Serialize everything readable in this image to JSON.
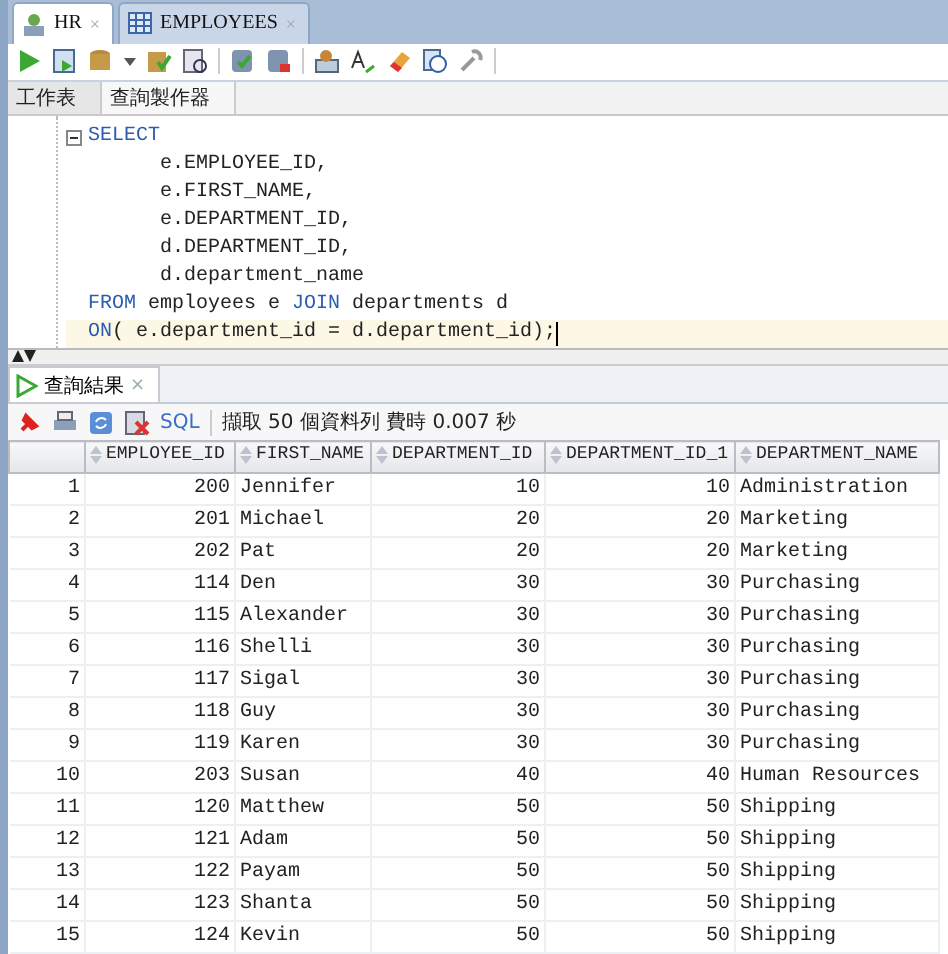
{
  "editor_tabs": [
    {
      "label": "HR",
      "kind": "connection",
      "selected": true,
      "close": "×"
    },
    {
      "label": "EMPLOYEES",
      "kind": "table",
      "selected": false,
      "close": "×"
    }
  ],
  "sub_tabs": [
    {
      "label": "工作表",
      "selected": true
    },
    {
      "label": "查詢製作器",
      "selected": false
    }
  ],
  "sql_lines": [
    {
      "current": false,
      "tokens": [
        {
          "kind": "keyword",
          "text": "SELECT"
        }
      ]
    },
    {
      "current": false,
      "tokens": [
        {
          "kind": "plain",
          "text": "      e.EMPLOYEE_ID,"
        }
      ]
    },
    {
      "current": false,
      "tokens": [
        {
          "kind": "plain",
          "text": "      e.FIRST_NAME,"
        }
      ]
    },
    {
      "current": false,
      "tokens": [
        {
          "kind": "plain",
          "text": "      e.DEPARTMENT_ID,"
        }
      ]
    },
    {
      "current": false,
      "tokens": [
        {
          "kind": "plain",
          "text": "      d.DEPARTMENT_ID,"
        }
      ]
    },
    {
      "current": false,
      "tokens": [
        {
          "kind": "plain",
          "text": "      d.department_name"
        }
      ]
    },
    {
      "current": false,
      "tokens": [
        {
          "kind": "keyword",
          "text": "FROM"
        },
        {
          "kind": "plain",
          "text": " employees e "
        },
        {
          "kind": "keyword",
          "text": "JOIN"
        },
        {
          "kind": "plain",
          "text": " departments d"
        }
      ]
    },
    {
      "current": true,
      "tokens": [
        {
          "kind": "keyword",
          "text": "ON"
        },
        {
          "kind": "plain",
          "text": "( e.department_id = d.department_id);"
        }
      ]
    }
  ],
  "results_tab": {
    "label": "查詢結果",
    "selected": true,
    "close": "×"
  },
  "results_toolbar": {
    "sql_link": "SQL",
    "status": "擷取 50 個資料列 費時 0.007 秒"
  },
  "table": {
    "columns": [
      "",
      "EMPLOYEE_ID",
      "FIRST_NAME",
      "DEPARTMENT_ID",
      "DEPARTMENT_ID_1",
      "DEPARTMENT_NAME"
    ],
    "rows": [
      [
        "1",
        "200",
        "Jennifer",
        "10",
        "10",
        "Administration"
      ],
      [
        "2",
        "201",
        "Michael",
        "20",
        "20",
        "Marketing"
      ],
      [
        "3",
        "202",
        "Pat",
        "20",
        "20",
        "Marketing"
      ],
      [
        "4",
        "114",
        "Den",
        "30",
        "30",
        "Purchasing"
      ],
      [
        "5",
        "115",
        "Alexander",
        "30",
        "30",
        "Purchasing"
      ],
      [
        "6",
        "116",
        "Shelli",
        "30",
        "30",
        "Purchasing"
      ],
      [
        "7",
        "117",
        "Sigal",
        "30",
        "30",
        "Purchasing"
      ],
      [
        "8",
        "118",
        "Guy",
        "30",
        "30",
        "Purchasing"
      ],
      [
        "9",
        "119",
        "Karen",
        "30",
        "30",
        "Purchasing"
      ],
      [
        "10",
        "203",
        "Susan",
        "40",
        "40",
        "Human Resources"
      ],
      [
        "11",
        "120",
        "Matthew",
        "50",
        "50",
        "Shipping"
      ],
      [
        "12",
        "121",
        "Adam",
        "50",
        "50",
        "Shipping"
      ],
      [
        "13",
        "122",
        "Payam",
        "50",
        "50",
        "Shipping"
      ],
      [
        "14",
        "123",
        "Shanta",
        "50",
        "50",
        "Shipping"
      ],
      [
        "15",
        "124",
        "Kevin",
        "50",
        "50",
        "Shipping"
      ]
    ]
  }
}
